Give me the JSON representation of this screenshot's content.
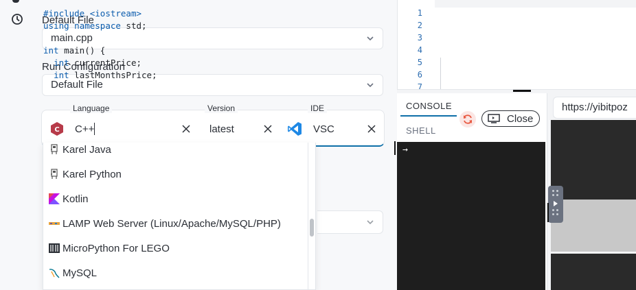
{
  "settings": {
    "default_file_label": "Default File",
    "default_file_value": "main.cpp",
    "run_config_label": "Run Configuration",
    "run_config_value": "Default File",
    "language_label": "Language",
    "language_value": "C++",
    "version_label": "Version",
    "version_value": "latest",
    "ide_label": "IDE",
    "ide_value": "VSC"
  },
  "language_options": [
    {
      "label": "Karel Java",
      "icon": "karel-robot-icon"
    },
    {
      "label": "Karel Python",
      "icon": "karel-robot-icon"
    },
    {
      "label": "Kotlin",
      "icon": "kotlin-icon"
    },
    {
      "label": "LAMP Web Server (Linux/Apache/MySQL/PHP)",
      "icon": "lamp-icon"
    },
    {
      "label": "MicroPython For LEGO",
      "icon": "micropython-icon"
    },
    {
      "label": "MySQL",
      "icon": "mysql-icon"
    }
  ],
  "editor": {
    "line_numbers": [
      "1",
      "2",
      "3",
      "4",
      "5",
      "6",
      "7"
    ],
    "lines": [
      "#include <iostream>",
      "using namespace std;",
      "",
      "int main() {",
      "  int currentPrice;",
      "  int lastMonthsPrice;",
      ""
    ]
  },
  "console": {
    "tab_console": "CONSOLE",
    "tab_shell": "SHELL",
    "close_label": "Close",
    "prompt": "→"
  },
  "browser": {
    "url": "https://yibitpoz"
  },
  "colors": {
    "accent": "#0e6fa8",
    "cpp_icon": "#b73b49",
    "vsc_icon": "#1e88e5",
    "refresh": "#e8573f",
    "terminal_bg": "#1e1e1e"
  }
}
